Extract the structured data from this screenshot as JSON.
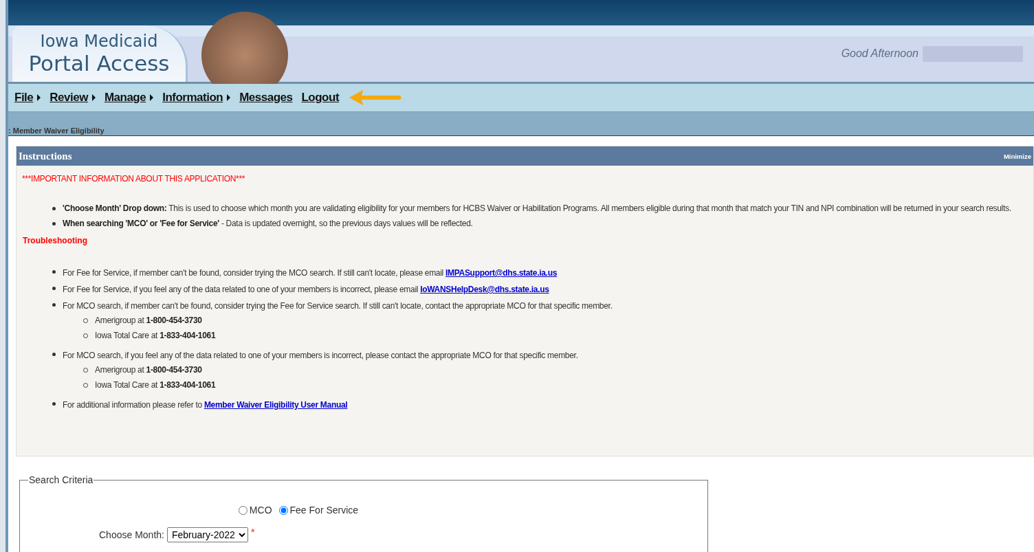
{
  "header": {
    "logo_line1": "Iowa Medicaid",
    "logo_line2": "Portal Access",
    "greeting": "Good Afternoon"
  },
  "menu": [
    {
      "label": "File",
      "has_submenu": true
    },
    {
      "label": "Review",
      "has_submenu": true
    },
    {
      "label": "Manage",
      "has_submenu": true
    },
    {
      "label": "Information",
      "has_submenu": true
    },
    {
      "label": "Messages",
      "has_submenu": false
    },
    {
      "label": "Logout",
      "has_submenu": false
    }
  ],
  "breadcrumb": ": Member Waiver Eligibility",
  "instructions": {
    "title": "Instructions",
    "minimize": "Minimize",
    "notice": "***IMPORTANT INFORMATION ABOUT THIS APPLICATION***",
    "items": [
      {
        "text": "**'Choose Month' Drop down:** This is used to choose which month you are validating eligibility for your members for HCBS Waiver or Habilitation Programs. All members eligible during that month that match your TIN and NPI combination will be returned in your search results."
      },
      {
        "text": "**When searching 'MCO' or 'Fee for Service'** - Data is updated overnight, so the previous days values will be reflected."
      }
    ],
    "troubleshooting_title": "Troubleshooting",
    "troubleshooting": [
      {
        "text": "For Fee for Service, if member can't be found, consider trying the MCO search. If still can't locate, please email ",
        "link": "IMPASupport@dhs.state.ia.us"
      },
      {
        "text": "For Fee for Service, if you feel any of the data related to one of your members is incorrect, please email ",
        "link": "IoWANSHelpDesk@dhs.state.ia.us"
      },
      {
        "text": "For MCO search, if member can't be found, consider trying the Fee for Service search. If still can't locate, contact the appropriate MCO for that specific member.",
        "children": [
          {
            "text": "Amerigroup at **1-800-454-3730**"
          },
          {
            "text": "Iowa Total Care at **1-833-404-1061**"
          }
        ]
      },
      {
        "text": "For MCO search, if you feel any of the data related to one of your members is incorrect, please contact the appropriate MCO for that specific member.",
        "children": [
          {
            "text": "Amerigroup at **1-800-454-3730**"
          },
          {
            "text": "Iowa Total Care at **1-833-404-1061**"
          }
        ]
      },
      {
        "text": "For additional information please refer to ",
        "link": "Member Waiver Eligibility User Manual"
      }
    ]
  },
  "search": {
    "legend": "Search Criteria",
    "options": [
      {
        "label": "MCO",
        "selected": false
      },
      {
        "label": "Fee For Service",
        "selected": true
      }
    ],
    "month_label": "Choose Month:",
    "month": "February-2022",
    "required_mark": "*"
  }
}
